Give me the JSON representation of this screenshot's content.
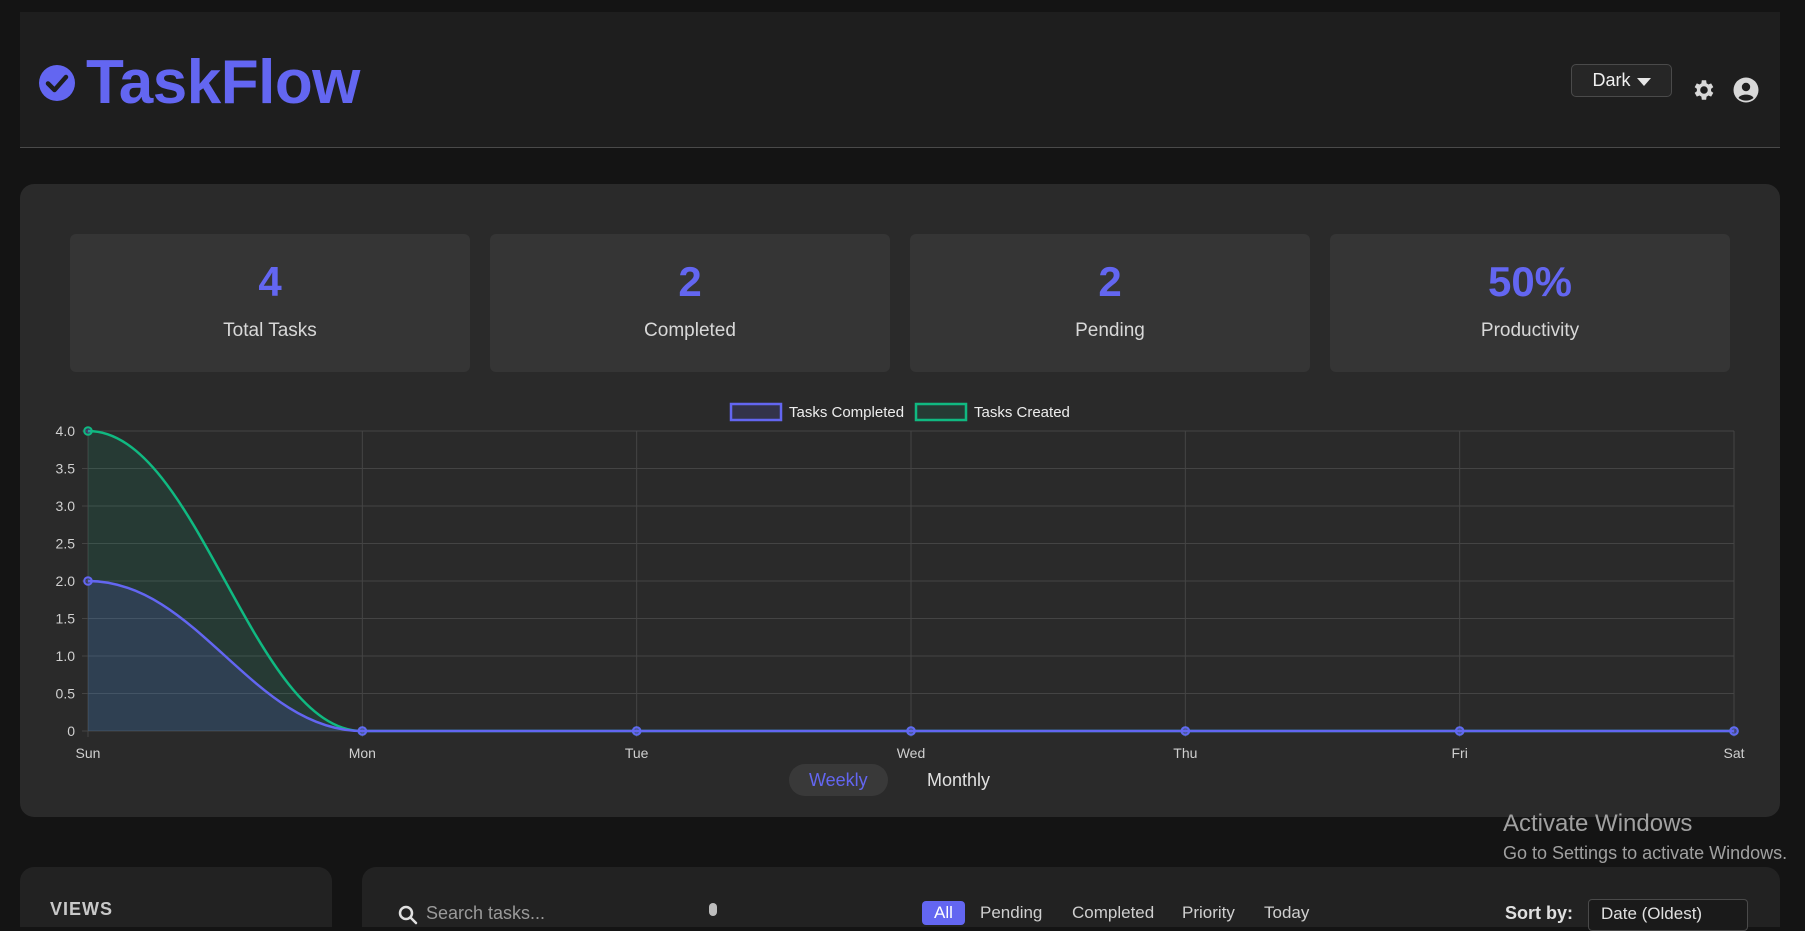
{
  "header": {
    "title": "TaskFlow",
    "theme_select": "Dark"
  },
  "stats": [
    {
      "value": "4",
      "label": "Total Tasks"
    },
    {
      "value": "2",
      "label": "Completed"
    },
    {
      "value": "2",
      "label": "Pending"
    },
    {
      "value": "50%",
      "label": "Productivity"
    }
  ],
  "chart_data": {
    "type": "line",
    "categories": [
      "Sun",
      "Mon",
      "Tue",
      "Wed",
      "Thu",
      "Fri",
      "Sat"
    ],
    "series": [
      {
        "name": "Tasks Completed",
        "values": [
          2,
          0,
          0,
          0,
          0,
          0,
          0
        ],
        "color": "#6366f1",
        "fill": "rgba(99,102,241,0.16)"
      },
      {
        "name": "Tasks Created",
        "values": [
          4,
          0,
          0,
          0,
          0,
          0,
          0
        ],
        "color": "#10b981",
        "fill": "rgba(16,185,129,0.12)"
      }
    ],
    "y_ticks": [
      "0",
      "0.5",
      "1.0",
      "1.5",
      "2.0",
      "2.5",
      "3.0",
      "3.5",
      "4.0"
    ],
    "ylim": [
      0,
      4
    ],
    "grid": true,
    "legend": "top-center"
  },
  "chart_toggle": {
    "weekly": "Weekly",
    "monthly": "Monthly"
  },
  "watermark": {
    "title": "Activate Windows",
    "subtitle": "Go to Settings to activate Windows."
  },
  "sidebar": {
    "views_label": "VIEWS"
  },
  "tasks": {
    "search_placeholder": "Search tasks...",
    "filters": [
      "All",
      "Pending",
      "Completed",
      "Priority",
      "Today"
    ],
    "sort_label": "Sort by:",
    "sort_value": "Date (Oldest)"
  }
}
